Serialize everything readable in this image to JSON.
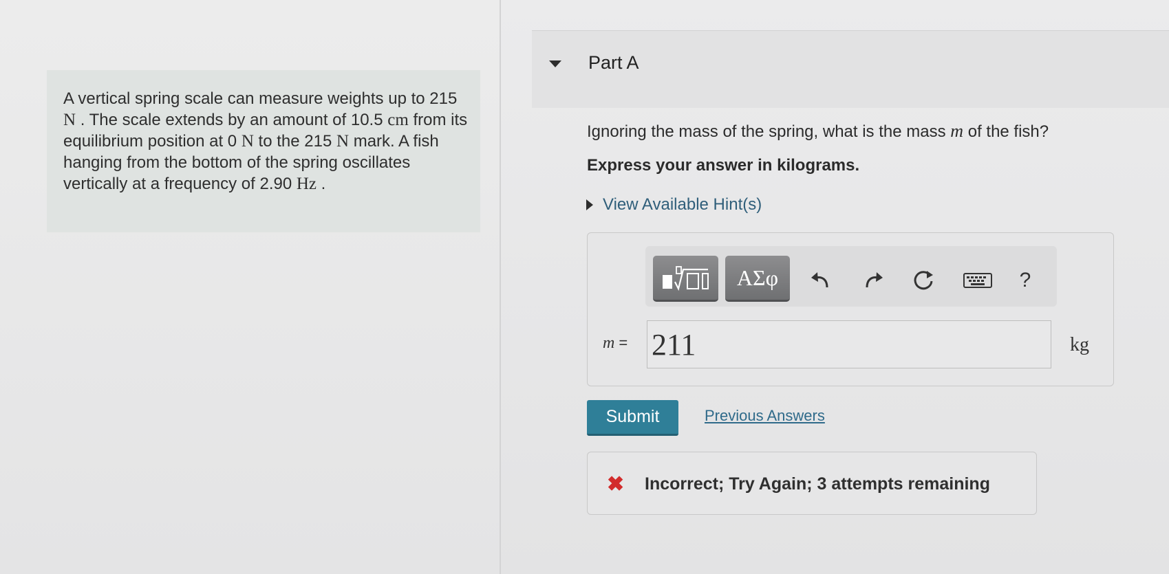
{
  "problem": {
    "parts": [
      {
        "text": "A vertical spring scale can measure weights up to 215 ",
        "unit": false
      },
      {
        "text": "N",
        "unit": true
      },
      {
        "text": " . The scale extends by an amount of 10.5 ",
        "unit": false
      },
      {
        "text": "cm",
        "unit": true
      },
      {
        "text": " from its equilibrium position at 0 ",
        "unit": false
      },
      {
        "text": "N",
        "unit": true
      },
      {
        "text": " to the 215 ",
        "unit": false
      },
      {
        "text": "N",
        "unit": true
      },
      {
        "text": " mark. A fish hanging from the bottom of the spring oscillates vertically at a frequency of 2.90 ",
        "unit": false
      },
      {
        "text": "Hz",
        "unit": true
      },
      {
        "text": " .",
        "unit": false
      }
    ]
  },
  "part": {
    "title": "Part A",
    "question_before": "Ignoring the mass of the spring, what is the mass ",
    "question_var": "m",
    "question_after": " of the fish?",
    "instruction": "Express your answer in kilograms.",
    "hints_label": "View Available Hint(s)"
  },
  "toolbar": {
    "templates_glyph": "▪√▯",
    "symbols_label": "ΑΣφ",
    "undo_glyph": "↶",
    "redo_glyph": "↷",
    "reset_glyph": "↻",
    "keyboard_glyph": "⌨",
    "help_glyph": "?",
    "icons": [
      "templates-icon",
      "symbols-icon",
      "undo-icon",
      "redo-icon",
      "reset-icon",
      "keyboard-icon",
      "help-icon"
    ]
  },
  "answer": {
    "variable": "m",
    "equals": "=",
    "value": "211",
    "unit": "kg"
  },
  "actions": {
    "submit_label": "Submit",
    "previous_answers_label": "Previous Answers"
  },
  "feedback": {
    "icon_glyph": "✖",
    "text": "Incorrect; Try Again; 3 attempts remaining",
    "status_color": "#d22c2c"
  },
  "colors": {
    "accent": "#2f7f98",
    "link": "#2f6a8a"
  }
}
